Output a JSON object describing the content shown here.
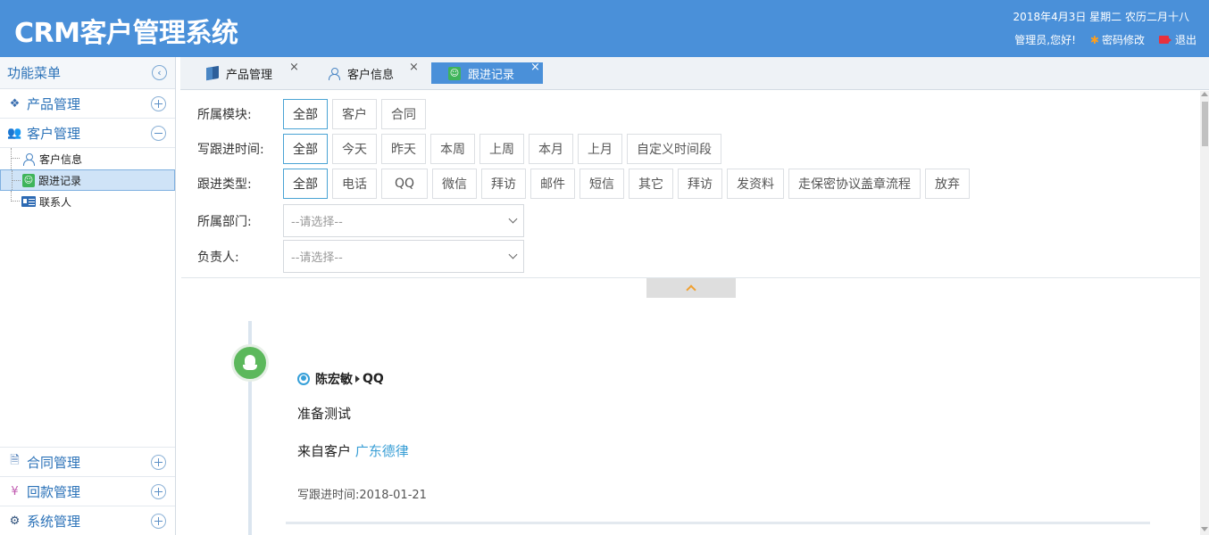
{
  "header": {
    "brand": "CRM客户管理系统",
    "datetime": "2018年4月3日 星期二 农历二月十八",
    "greeting": "管理员,您好!",
    "change_password": "密码修改",
    "logout": "退出"
  },
  "sidebar": {
    "title": "功能菜单",
    "groups": [
      {
        "label": "产品管理",
        "icon": "cubes-icon"
      },
      {
        "label": "客户管理",
        "icon": "users-icon"
      }
    ],
    "sub_items": [
      {
        "label": "客户信息",
        "icon": "person-outline-icon"
      },
      {
        "label": "跟进记录",
        "icon": "followup-icon"
      },
      {
        "label": "联系人",
        "icon": "contact-card-icon"
      }
    ],
    "bottom_groups": [
      {
        "label": "合同管理",
        "icon": "document-icon"
      },
      {
        "label": "回款管理",
        "icon": "yen-icon"
      },
      {
        "label": "系统管理",
        "icon": "gear-icon"
      }
    ]
  },
  "tabs": [
    {
      "label": "产品管理",
      "close": "×"
    },
    {
      "label": "客户信息",
      "close": "×"
    },
    {
      "label": "跟进记录",
      "close": "×"
    }
  ],
  "filters": {
    "module": {
      "label": "所属模块:",
      "options": [
        "全部",
        "客户",
        "合同"
      ]
    },
    "time": {
      "label": "写跟进时间:",
      "options": [
        "全部",
        "今天",
        "昨天",
        "本周",
        "上周",
        "本月",
        "上月",
        "自定义时间段"
      ]
    },
    "type": {
      "label": "跟进类型:",
      "options": [
        "全部",
        "电话",
        "QQ",
        "微信",
        "拜访",
        "邮件",
        "短信",
        "其它",
        "拜访",
        "发资料",
        "走保密协议盖章流程",
        "放弃"
      ]
    },
    "dept": {
      "label": "所属部门:",
      "placeholder": "--请选择--"
    },
    "owner": {
      "label": "负责人:",
      "placeholder": "--请选择--"
    }
  },
  "record": {
    "person": "陈宏敏",
    "type": "QQ",
    "content": "准备测试",
    "source_prefix": "来自客户",
    "source_link": "广东德律",
    "time": "写跟进时间:2018-01-21"
  },
  "colors": {
    "header": "#4a90d9",
    "accent": "#4aa3d4",
    "timeline_dot": "#5cb85c"
  }
}
